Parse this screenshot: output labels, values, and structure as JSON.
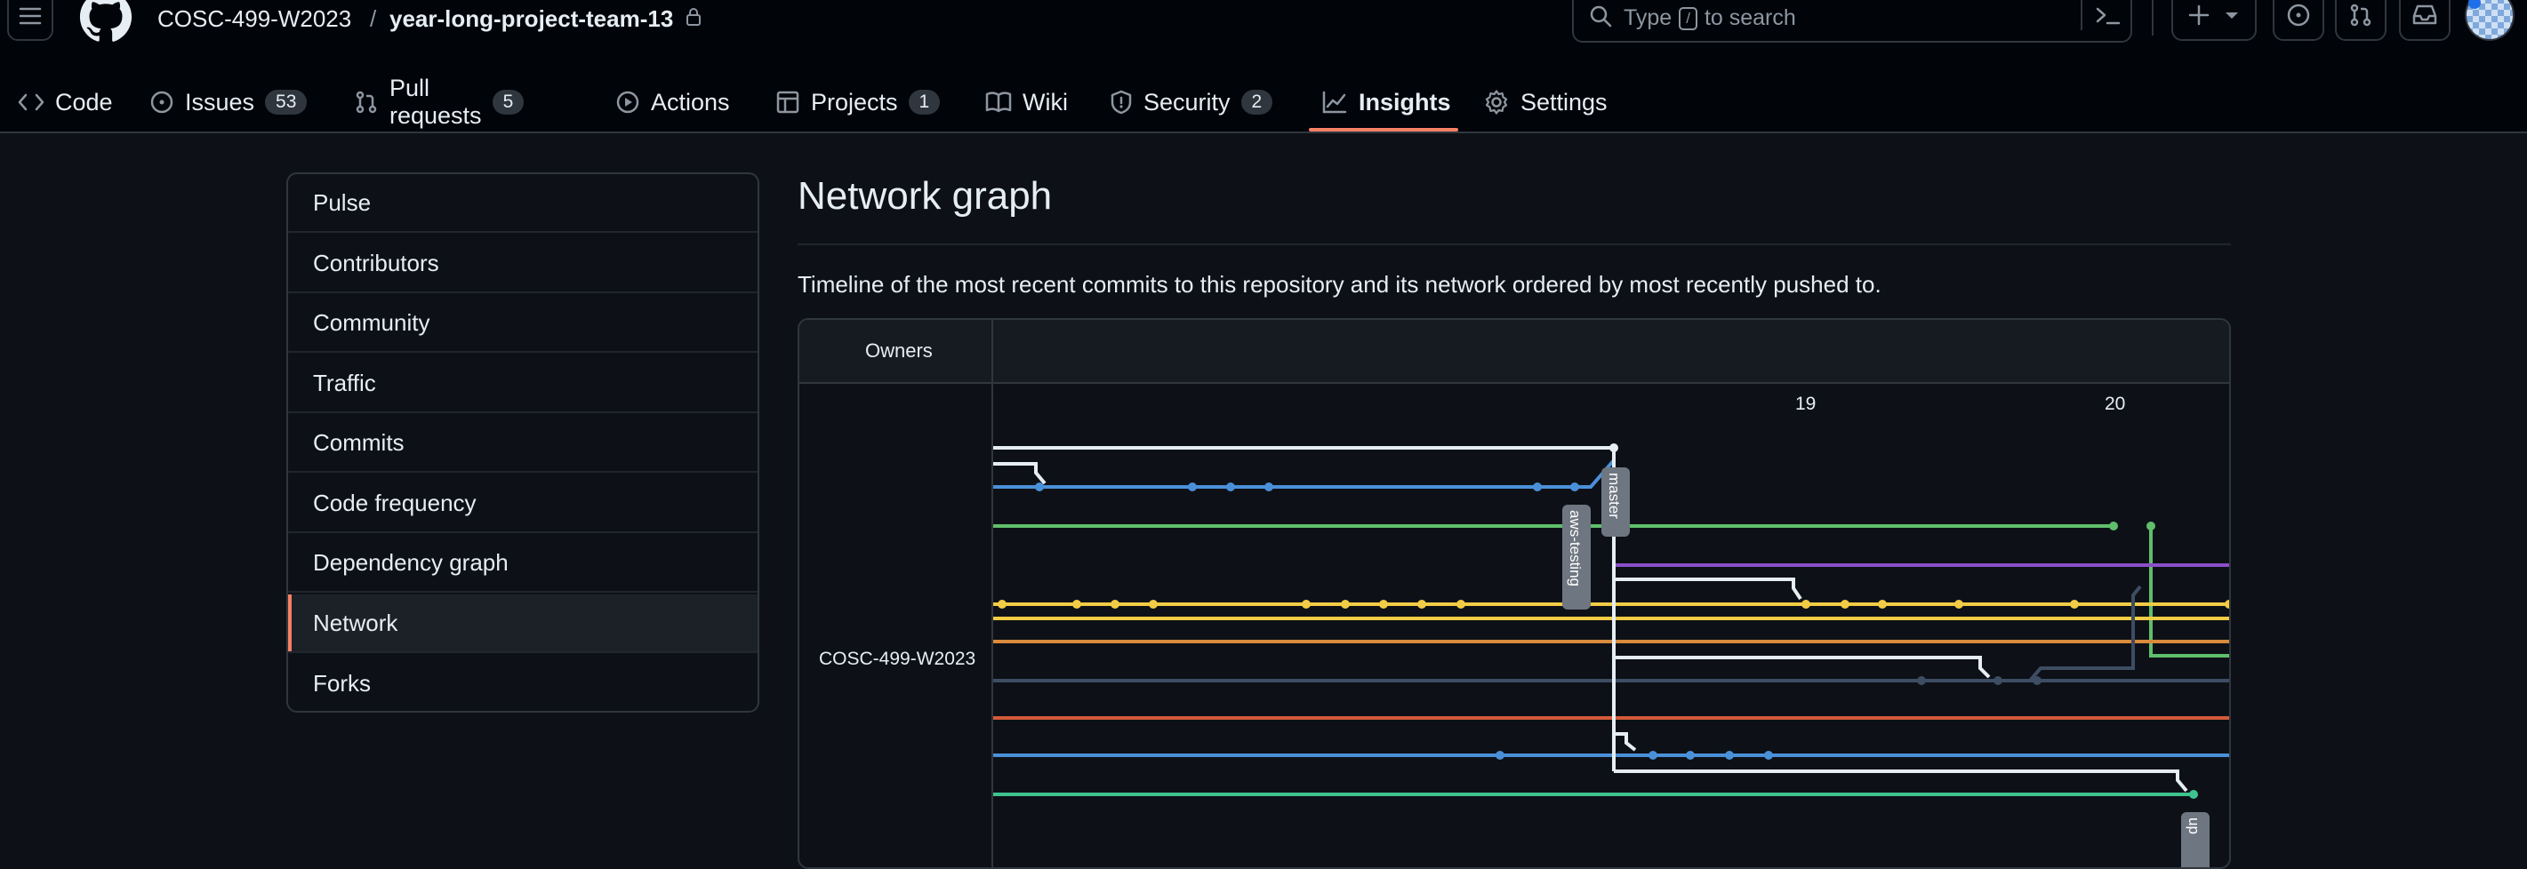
{
  "repo": {
    "owner": "COSC-499-W2023",
    "separator": "/",
    "name": "year-long-project-team-13"
  },
  "search": {
    "prefix": "Type",
    "key": "/",
    "suffix": "to search"
  },
  "tabs": [
    {
      "label": "Code",
      "icon": "code-icon"
    },
    {
      "label": "Issues",
      "count": "53",
      "icon": "issue-icon"
    },
    {
      "label": "Pull requests",
      "count": "5",
      "icon": "pull-request-icon"
    },
    {
      "label": "Actions",
      "icon": "play-icon"
    },
    {
      "label": "Projects",
      "count": "1",
      "icon": "table-icon"
    },
    {
      "label": "Wiki",
      "icon": "book-icon"
    },
    {
      "label": "Security",
      "count": "2",
      "icon": "shield-icon"
    },
    {
      "label": "Insights",
      "icon": "graph-icon",
      "active": true
    },
    {
      "label": "Settings",
      "icon": "gear-icon"
    }
  ],
  "sidebar": {
    "items": [
      {
        "label": "Pulse"
      },
      {
        "label": "Contributors"
      },
      {
        "label": "Community"
      },
      {
        "label": "Traffic"
      },
      {
        "label": "Commits"
      },
      {
        "label": "Code frequency"
      },
      {
        "label": "Dependency graph"
      },
      {
        "label": "Network",
        "selected": true
      },
      {
        "label": "Forks"
      }
    ]
  },
  "main": {
    "title": "Network graph",
    "description": "Timeline of the most recent commits to this repository and its network ordered by most recently pushed to."
  },
  "network": {
    "owners_header": "Owners",
    "owner": "COSC-499-W2023",
    "dates": [
      "19",
      "20"
    ],
    "branch_labels": [
      "master",
      "aws-testing",
      "up"
    ]
  },
  "colors": {
    "accent": "#f78166",
    "background": "#0d1117",
    "branch_white": "#e6edf3",
    "branch_blue": "#4a90d9",
    "branch_green": "#5fbf6b",
    "branch_purple": "#8b4fc9",
    "branch_yellow": "#f2cc45",
    "branch_orange": "#d98a3c",
    "branch_slate": "#3d4d63",
    "branch_red": "#d45a3a",
    "branch_teal": "#3ec28f"
  }
}
